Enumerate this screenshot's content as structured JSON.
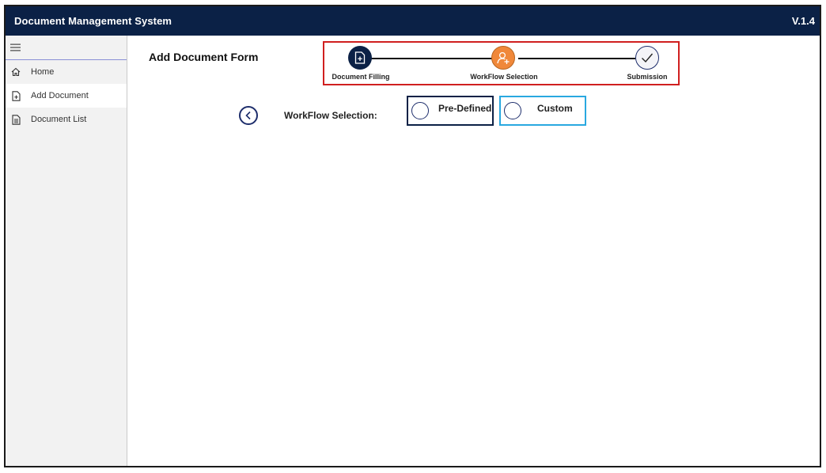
{
  "header": {
    "title": "Document Management System",
    "version": "V.1.4"
  },
  "sidebar": {
    "items": [
      {
        "label": "Home",
        "icon": "home-icon"
      },
      {
        "label": "Add Document",
        "icon": "document-add-icon",
        "active": true
      },
      {
        "label": "Document List",
        "icon": "document-list-icon"
      }
    ]
  },
  "form": {
    "title": "Add Document Form",
    "workflow_label": "WorkFlow Selection:",
    "options": [
      {
        "label": "Pre-Defined"
      },
      {
        "label": "Custom"
      }
    ]
  },
  "stepper": {
    "steps": [
      {
        "label": "Document Filling",
        "state": "completed",
        "icon": "document-add-icon"
      },
      {
        "label": "WorkFlow Selection",
        "state": "current",
        "icon": "user-add-icon"
      },
      {
        "label": "Submission",
        "state": "pending",
        "icon": "check-icon"
      }
    ]
  },
  "colors": {
    "header_bg": "#0b2146",
    "accent_orange": "#f0883a",
    "stepper_border": "#d01f1f",
    "custom_border": "#29a8e0",
    "predefined_border": "#0b2146"
  }
}
